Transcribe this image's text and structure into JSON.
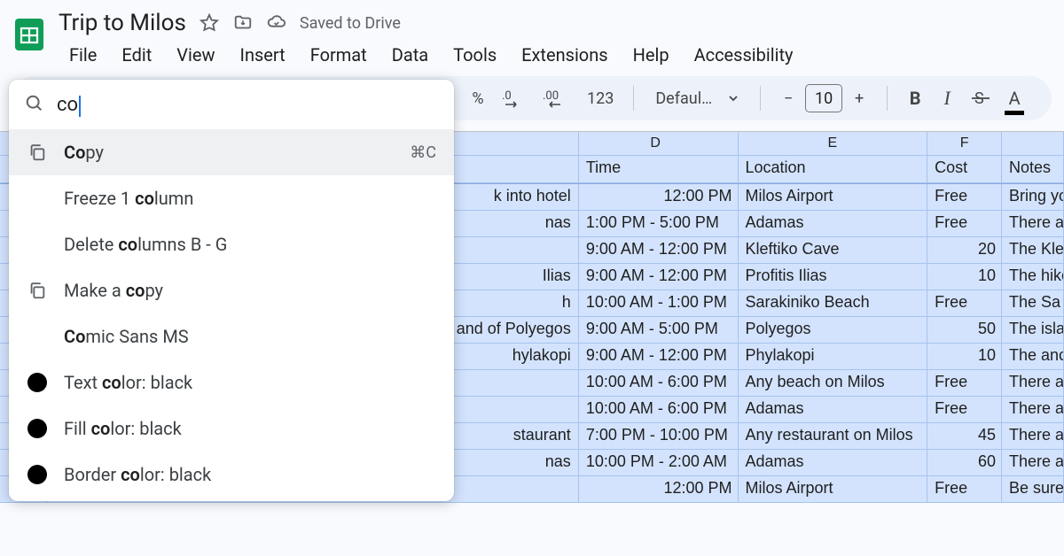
{
  "header": {
    "title": "Trip to Milos",
    "saved": "Saved to Drive",
    "menus": [
      "File",
      "Edit",
      "View",
      "Insert",
      "Format",
      "Data",
      "Tools",
      "Extensions",
      "Help",
      "Accessibility"
    ]
  },
  "toolbar": {
    "percent": "%",
    "dec_dec": ".0",
    "dec_inc": ".00",
    "num123": "123",
    "font": "Defaul…",
    "fsize_minus": "−",
    "fsize": "10",
    "fsize_plus": "+",
    "bold": "B",
    "italic": "I",
    "strike": "S",
    "textcolor": "A"
  },
  "search": {
    "query": "co",
    "items": [
      {
        "icon": "copy",
        "label_pre": "",
        "label_hl": "Co",
        "label_post": "py",
        "shortcut": "⌘C",
        "active": true
      },
      {
        "icon": "",
        "label_pre": "Freeze 1 ",
        "label_hl": "co",
        "label_post": "lumn",
        "shortcut": ""
      },
      {
        "icon": "",
        "label_pre": "Delete ",
        "label_hl": "co",
        "label_post": "lumns B - G",
        "shortcut": ""
      },
      {
        "icon": "copy",
        "label_pre": "Make a ",
        "label_hl": "co",
        "label_post": "py",
        "shortcut": ""
      },
      {
        "icon": "",
        "label_pre": "",
        "label_hl": "Co",
        "label_post": "mic Sans MS",
        "shortcut": ""
      },
      {
        "icon": "swatch",
        "label_pre": "Text ",
        "label_hl": "co",
        "label_post": "lor: black",
        "shortcut": ""
      },
      {
        "icon": "swatch",
        "label_pre": "Fill ",
        "label_hl": "co",
        "label_post": "lor: black",
        "shortcut": ""
      },
      {
        "icon": "swatch",
        "label_pre": "Border ",
        "label_hl": "co",
        "label_post": "lor: black",
        "shortcut": ""
      }
    ]
  },
  "sheet": {
    "cols": [
      "D",
      "E",
      "F"
    ],
    "headers": {
      "d": "Time",
      "e": "Location",
      "f": "Cost",
      "g": "Notes"
    },
    "rows": [
      {
        "c": "k into hotel",
        "d": "12:00 PM",
        "d_align": "r",
        "e": "Milos Airport",
        "f": "Free",
        "f_align": "l",
        "g": "Bring yo"
      },
      {
        "c": "nas",
        "d": "1:00 PM - 5:00 PM",
        "d_align": "l",
        "e": "Adamas",
        "f": "Free",
        "f_align": "l",
        "g": "There a"
      },
      {
        "c": "",
        "d": "9:00 AM - 12:00 PM",
        "d_align": "l",
        "e": "Kleftiko Cave",
        "f": "20",
        "f_align": "r",
        "g": "The Kle"
      },
      {
        "c": "Ilias",
        "d": "9:00 AM - 12:00 PM",
        "d_align": "l",
        "e": "Profitis Ilias",
        "f": "10",
        "f_align": "r",
        "g": "The hike"
      },
      {
        "c": "h",
        "d": "10:00 AM - 1:00 PM",
        "d_align": "l",
        "e": "Sarakiniko Beach",
        "f": "Free",
        "f_align": "l",
        "g": "The Sa"
      },
      {
        "c": "and of Polyegos",
        "d": "9:00 AM - 5:00 PM",
        "d_align": "l",
        "e": "Polyegos",
        "f": "50",
        "f_align": "r",
        "g": "The isla"
      },
      {
        "c": "hylakopi",
        "d": "9:00 AM - 12:00 PM",
        "d_align": "l",
        "e": "Phylakopi",
        "f": "10",
        "f_align": "r",
        "g": "The anc"
      },
      {
        "c": "",
        "d": "10:00 AM - 6:00 PM",
        "d_align": "l",
        "e": "Any beach on Milos",
        "f": "Free",
        "f_align": "l",
        "g": "There a"
      },
      {
        "c": "",
        "d": "10:00 AM - 6:00 PM",
        "d_align": "l",
        "e": "Adamas",
        "f": "Free",
        "f_align": "l",
        "g": "There a"
      },
      {
        "c": "staurant",
        "d": "7:00 PM - 10:00 PM",
        "d_align": "l",
        "e": "Any restaurant on Milos",
        "f": "45",
        "f_align": "r",
        "g": "There a"
      },
      {
        "c": "nas",
        "d": "10:00 PM - 2:00 AM",
        "d_align": "l",
        "e": "Adamas",
        "f": "60",
        "f_align": "r",
        "g": "There a"
      },
      {
        "c": "",
        "d": "12:00 PM",
        "d_align": "r",
        "e": "Milos Airport",
        "f": "Free",
        "f_align": "l",
        "g": "Be sure"
      }
    ]
  }
}
